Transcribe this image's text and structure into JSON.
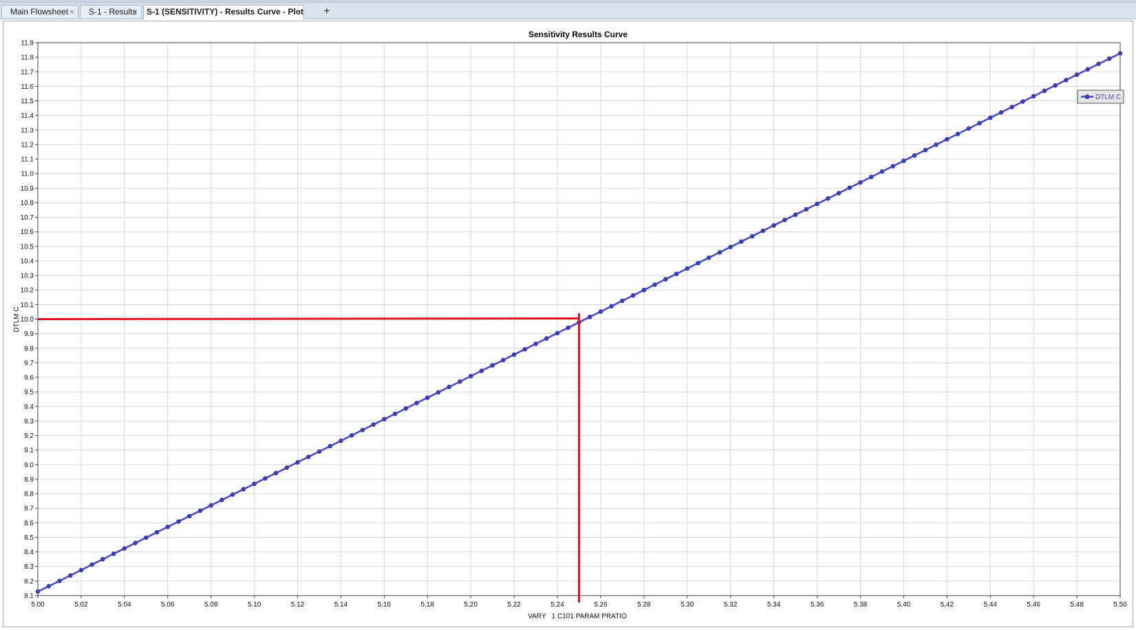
{
  "tabs": [
    {
      "label": "Main Flowsheet",
      "active": false
    },
    {
      "label": "S-1 - Results",
      "active": false
    },
    {
      "label": "S-1 (SENSITIVITY) - Results Curve - Plot",
      "active": true
    }
  ],
  "tab_close_glyph": "×",
  "new_tab_glyph": "+",
  "icons": {
    "close": "close-icon",
    "add_tab": "plus-icon",
    "legend_marker": "line-dot-marker-icon"
  },
  "colors": {
    "series": "#4646c8",
    "marker": "#3c3cb4",
    "annotation": "#e0141e",
    "grid": "#d8d8d8"
  },
  "chart_data": {
    "type": "line",
    "title": "Sensitivity Results Curve",
    "xlabel": "VARY   1 C101 PARAM PRATIO",
    "ylabel": "DTLM C",
    "xlim": [
      5.0,
      5.5
    ],
    "ylim": [
      8.1,
      11.9
    ],
    "xticks": [
      "5.00",
      "5.02",
      "5.04",
      "5.06",
      "5.08",
      "5.10",
      "5.12",
      "5.14",
      "5.16",
      "5.18",
      "5.20",
      "5.22",
      "5.24",
      "5.26",
      "5.28",
      "5.30",
      "5.32",
      "5.34",
      "5.36",
      "5.38",
      "5.40",
      "5.42",
      "5.44",
      "5.46",
      "5.48",
      "5.50"
    ],
    "yticks": [
      "8.1",
      "8.2",
      "8.3",
      "8.4",
      "8.5",
      "8.6",
      "8.7",
      "8.8",
      "8.9",
      "9.0",
      "9.1",
      "9.2",
      "9.3",
      "9.4",
      "9.5",
      "9.6",
      "9.7",
      "9.8",
      "9.9",
      "10.0",
      "10.1",
      "10.2",
      "10.3",
      "10.4",
      "10.5",
      "10.6",
      "10.7",
      "10.8",
      "10.9",
      "11.0",
      "11.1",
      "11.2",
      "11.3",
      "11.4",
      "11.5",
      "11.6",
      "11.7",
      "11.8",
      "11.9"
    ],
    "grid": true,
    "legend_position": "top-right",
    "series": [
      {
        "name": "DTLM C",
        "x": [
          5.0,
          5.005,
          5.01,
          5.015,
          5.02,
          5.025,
          5.03,
          5.035,
          5.04,
          5.045,
          5.05,
          5.055,
          5.06,
          5.065,
          5.07,
          5.075,
          5.08,
          5.085,
          5.09,
          5.095,
          5.1,
          5.105,
          5.11,
          5.115,
          5.12,
          5.125,
          5.13,
          5.135,
          5.14,
          5.145,
          5.15,
          5.155,
          5.16,
          5.165,
          5.17,
          5.175,
          5.18,
          5.185,
          5.19,
          5.195,
          5.2,
          5.205,
          5.21,
          5.215,
          5.22,
          5.225,
          5.23,
          5.235,
          5.24,
          5.245,
          5.25,
          5.255,
          5.26,
          5.265,
          5.27,
          5.275,
          5.28,
          5.285,
          5.29,
          5.295,
          5.3,
          5.305,
          5.31,
          5.315,
          5.32,
          5.325,
          5.33,
          5.335,
          5.34,
          5.345,
          5.35,
          5.355,
          5.36,
          5.365,
          5.37,
          5.375,
          5.38,
          5.385,
          5.39,
          5.395,
          5.4,
          5.405,
          5.41,
          5.415,
          5.42,
          5.425,
          5.43,
          5.435,
          5.44,
          5.445,
          5.45,
          5.455,
          5.46,
          5.465,
          5.47,
          5.475,
          5.48,
          5.485,
          5.49,
          5.495,
          5.5
        ],
        "y": [
          8.128,
          8.164,
          8.201,
          8.238,
          8.275,
          8.313,
          8.35,
          8.387,
          8.424,
          8.461,
          8.498,
          8.535,
          8.572,
          8.609,
          8.646,
          8.683,
          8.72,
          8.757,
          8.794,
          8.831,
          8.868,
          8.905,
          8.942,
          8.979,
          9.016,
          9.053,
          9.09,
          9.127,
          9.164,
          9.201,
          9.238,
          9.275,
          9.312,
          9.349,
          9.386,
          9.423,
          9.46,
          9.497,
          9.534,
          9.571,
          9.608,
          9.645,
          9.682,
          9.719,
          9.756,
          9.793,
          9.83,
          9.867,
          9.904,
          9.941,
          9.978,
          10.015,
          10.052,
          10.089,
          10.126,
          10.163,
          10.2,
          10.237,
          10.274,
          10.311,
          10.348,
          10.385,
          10.422,
          10.459,
          10.496,
          10.533,
          10.57,
          10.607,
          10.644,
          10.681,
          10.718,
          10.755,
          10.792,
          10.829,
          10.866,
          10.903,
          10.94,
          10.977,
          11.014,
          11.051,
          11.088,
          11.125,
          11.162,
          11.199,
          11.236,
          11.273,
          11.31,
          11.347,
          11.384,
          11.421,
          11.458,
          11.495,
          11.532,
          11.569,
          11.606,
          11.643,
          11.68,
          11.717,
          11.754,
          11.79,
          11.827
        ]
      }
    ],
    "annotations": [
      {
        "type": "hline",
        "y": 10.0,
        "x_from": 5.0,
        "x_to": 5.25,
        "color": "#e0141e"
      },
      {
        "type": "vline",
        "x": 5.25,
        "y_from": 8.1,
        "y_to": 10.04,
        "color": "#e0141e"
      }
    ]
  }
}
